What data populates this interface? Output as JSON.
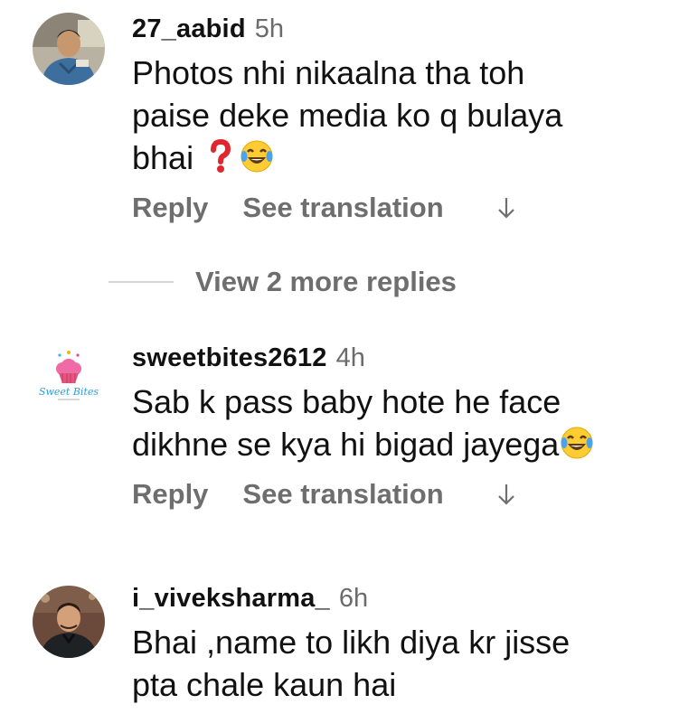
{
  "comments": [
    {
      "username": "27_aabid",
      "time": "5h",
      "text_line1": "Photos nhi nikaalna tha toh",
      "text_line2": "paise deke media ko q bulaya",
      "text_line3": "bhai",
      "emojis": [
        "red-question-mark",
        "face-with-tears-of-joy"
      ],
      "reply_label": "Reply",
      "translate_label": "See translation"
    },
    {
      "username": "sweetbites2612",
      "time": "4h",
      "text_line1": "Sab k pass baby hote he face",
      "text_line2": "dikhne se kya hi bigad jayega",
      "emojis": [
        "face-with-tears-of-joy"
      ],
      "avatar_text": "Sweet Bites",
      "reply_label": "Reply",
      "translate_label": "See translation"
    },
    {
      "username": "i_viveksharma_",
      "time": "6h",
      "text_line1": "Bhai ,name to likh diya kr jisse",
      "text_line2": "pta chale kaun hai"
    }
  ],
  "view_more_replies": "View 2 more replies",
  "colors": {
    "secondary_text": "#6e6e6e",
    "divider": "#d6d6d6",
    "background": "#ffffff"
  }
}
